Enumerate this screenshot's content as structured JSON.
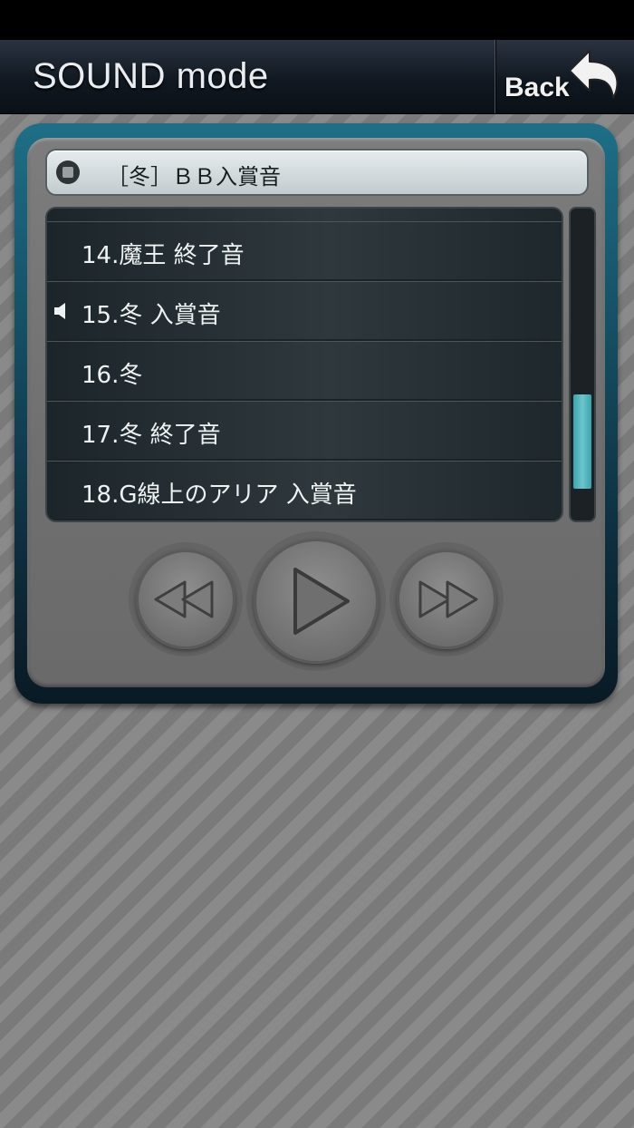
{
  "header": {
    "title": "SOUND mode",
    "back_label": "Back"
  },
  "player": {
    "now_playing": "［冬］ＢＢ入賞音",
    "tracks": [
      {
        "label": "14.魔王 終了音",
        "playing": false
      },
      {
        "label": "15.冬 入賞音",
        "playing": true
      },
      {
        "label": "16.冬",
        "playing": false
      },
      {
        "label": "17.冬 終了音",
        "playing": false
      },
      {
        "label": "18.G線上のアリア 入賞音",
        "playing": false
      }
    ],
    "controls": {
      "rewind_icon": "rewind-icon",
      "play_icon": "play-icon",
      "forward_icon": "fast-forward-icon"
    }
  },
  "colors": {
    "frame_accent": "#1d6f87",
    "scroll_thumb": "#6cc6cd"
  }
}
